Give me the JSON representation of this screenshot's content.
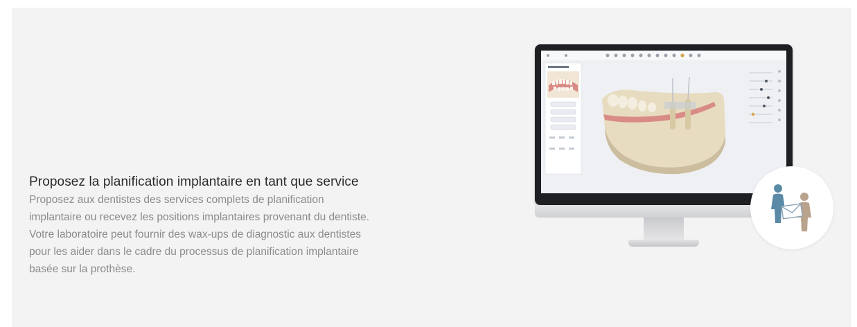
{
  "section": {
    "title": "Proposez la planification implantaire en tant que service",
    "description_lines": [
      "Proposez aux dentistes des services complets de planification",
      "implantaire ou recevez les positions implantaires provenant du dentiste.",
      "Votre laboratoire peut fournir des wax-ups de diagnostic aux dentistes",
      "pour les aider dans le cadre du processus de planification implantaire",
      "basée sur la prothèse."
    ]
  },
  "illustration": {
    "monitor_icon": "desktop-monitor-icon",
    "badge_icon": "people-exchange-icon",
    "colors": {
      "person_blue": "#5b8aa6",
      "person_tan": "#b8a38c",
      "envelope": "#c9d6df",
      "jaw": "#e8dcc0",
      "gum": "#d98b86"
    }
  }
}
